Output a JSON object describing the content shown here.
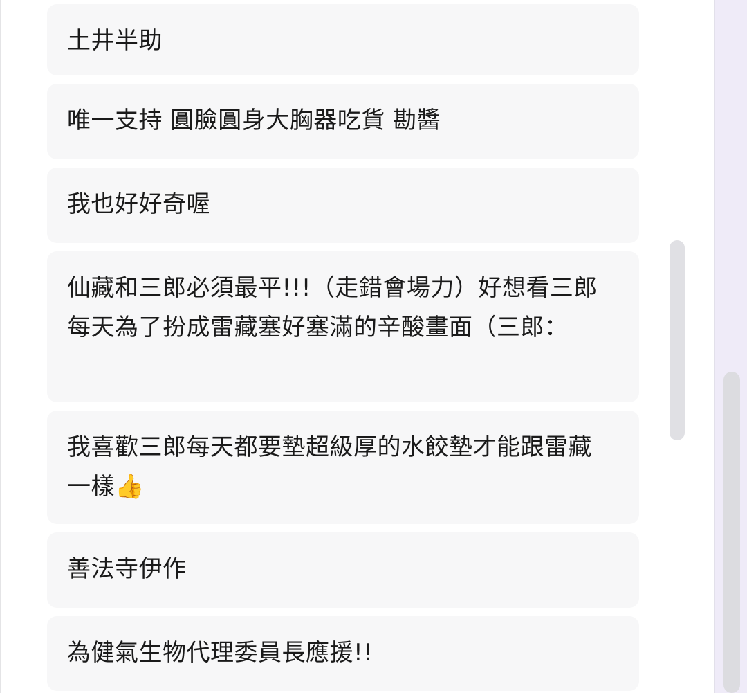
{
  "items": [
    {
      "text": "土井半助"
    },
    {
      "text": "唯一支持 圓臉圓身大胸器吃貨 勘醬"
    },
    {
      "text": "我也好好奇喔"
    },
    {
      "text": "仙藏和三郎必須最平!!!（走錯會場力）好想看三郎每天為了扮成雷藏塞好塞滿的辛酸畫面（三郎："
    },
    {
      "text": "我喜歡三郎每天都要墊超級厚的水餃墊才能跟雷藏一樣",
      "emoji": "👍"
    },
    {
      "text": "善法寺伊作"
    },
    {
      "text": "為健氣生物代理委員長應援!!"
    }
  ]
}
